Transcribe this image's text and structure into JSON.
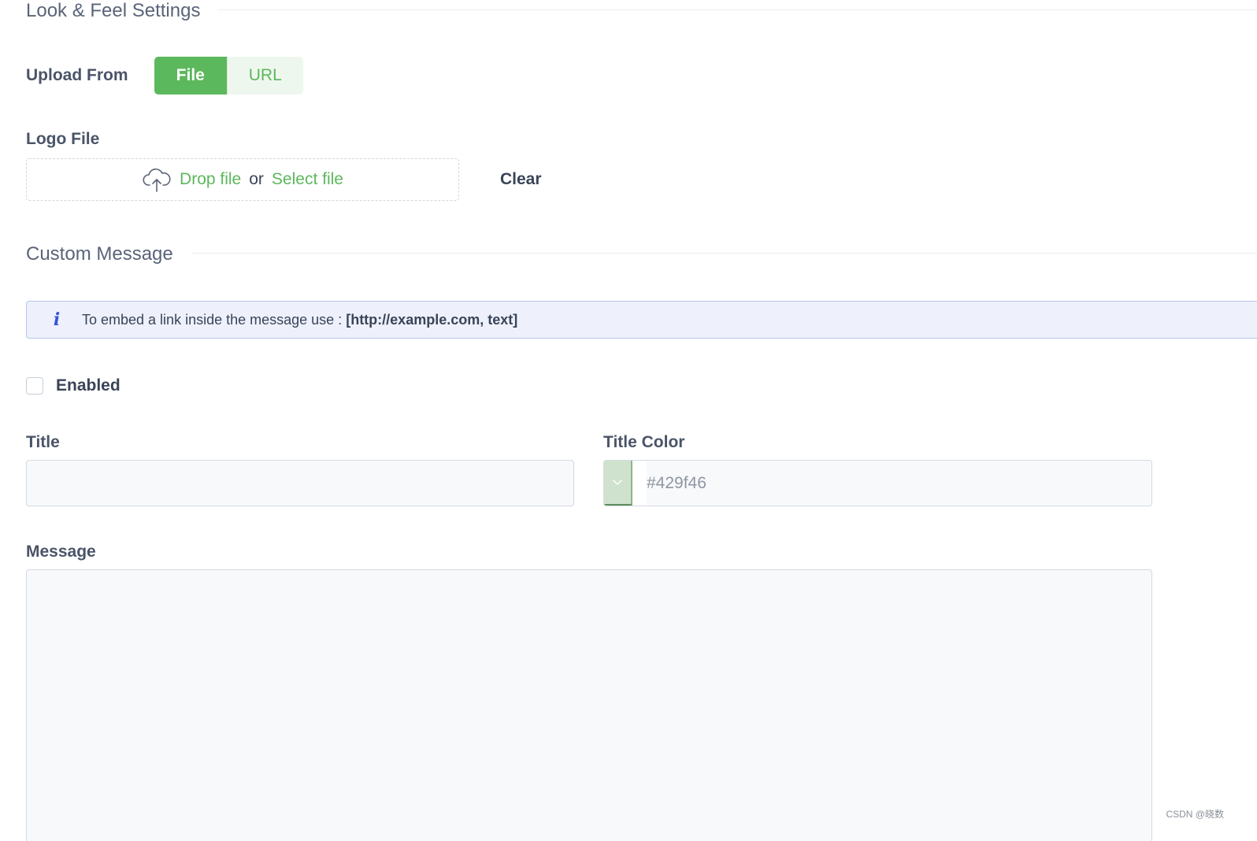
{
  "look_feel": {
    "heading": "Look & Feel Settings",
    "upload_from_label": "Upload From",
    "upload_options": [
      "File",
      "URL"
    ],
    "upload_selected": "File",
    "logo_file_label": "Logo File",
    "drop_file": "Drop file",
    "drop_or": "or",
    "select_file": "Select file",
    "clear_label": "Clear"
  },
  "custom_message": {
    "heading": "Custom Message",
    "info_text": "To embed a link inside the message use : ",
    "info_code": "[http://example.com, text]",
    "enabled_label": "Enabled",
    "enabled_checked": false,
    "title_label": "Title",
    "title_value": "",
    "title_color_label": "Title Color",
    "title_color_placeholder": "#429f46",
    "message_label": "Message",
    "message_value": ""
  },
  "icons": {
    "upload": "cloud-upload-icon",
    "info": "info-icon",
    "swatch": "chevron-down-icon"
  },
  "colors": {
    "accent": "#5cb85c",
    "info_accent": "#3553d8",
    "title_color": "#429f46"
  },
  "watermark": "CSDN @晓数"
}
